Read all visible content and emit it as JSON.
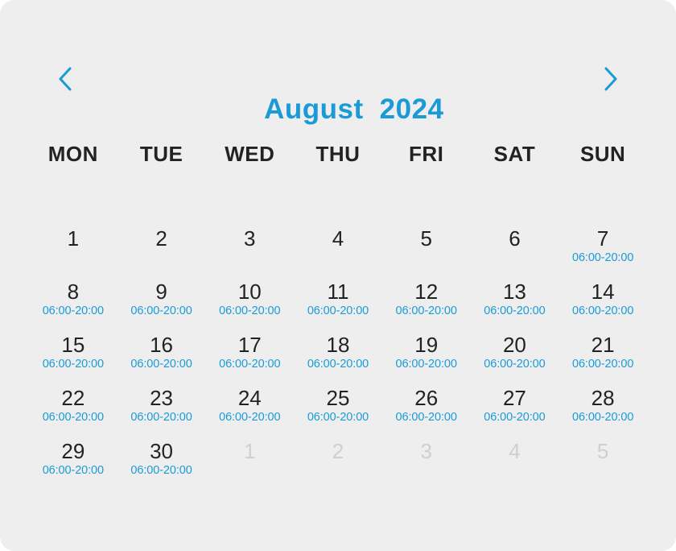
{
  "calendar": {
    "month": "August",
    "year": "2024",
    "accent_color": "#1a9bd7",
    "prev_icon": "chevron-left-icon",
    "next_icon": "chevron-right-icon",
    "weekdays": [
      "MON",
      "TUE",
      "WED",
      "THU",
      "FRI",
      "SAT",
      "SUN"
    ],
    "leading_blanks": 0,
    "days": [
      {
        "day": "1",
        "hours": ""
      },
      {
        "day": "2",
        "hours": ""
      },
      {
        "day": "3",
        "hours": ""
      },
      {
        "day": "4",
        "hours": ""
      },
      {
        "day": "5",
        "hours": ""
      },
      {
        "day": "6",
        "hours": ""
      },
      {
        "day": "7",
        "hours": "06:00-20:00"
      },
      {
        "day": "8",
        "hours": "06:00-20:00"
      },
      {
        "day": "9",
        "hours": "06:00-20:00"
      },
      {
        "day": "10",
        "hours": "06:00-20:00"
      },
      {
        "day": "11",
        "hours": "06:00-20:00"
      },
      {
        "day": "12",
        "hours": "06:00-20:00"
      },
      {
        "day": "13",
        "hours": "06:00-20:00"
      },
      {
        "day": "14",
        "hours": "06:00-20:00"
      },
      {
        "day": "15",
        "hours": "06:00-20:00"
      },
      {
        "day": "16",
        "hours": "06:00-20:00"
      },
      {
        "day": "17",
        "hours": "06:00-20:00"
      },
      {
        "day": "18",
        "hours": "06:00-20:00"
      },
      {
        "day": "19",
        "hours": "06:00-20:00"
      },
      {
        "day": "20",
        "hours": "06:00-20:00"
      },
      {
        "day": "21",
        "hours": "06:00-20:00"
      },
      {
        "day": "22",
        "hours": "06:00-20:00"
      },
      {
        "day": "23",
        "hours": "06:00-20:00"
      },
      {
        "day": "24",
        "hours": "06:00-20:00"
      },
      {
        "day": "25",
        "hours": "06:00-20:00"
      },
      {
        "day": "26",
        "hours": "06:00-20:00"
      },
      {
        "day": "27",
        "hours": "06:00-20:00"
      },
      {
        "day": "28",
        "hours": "06:00-20:00"
      },
      {
        "day": "29",
        "hours": "06:00-20:00"
      },
      {
        "day": "30",
        "hours": "06:00-20:00"
      }
    ],
    "next_month_days": [
      "1",
      "2",
      "3",
      "4",
      "5"
    ]
  }
}
